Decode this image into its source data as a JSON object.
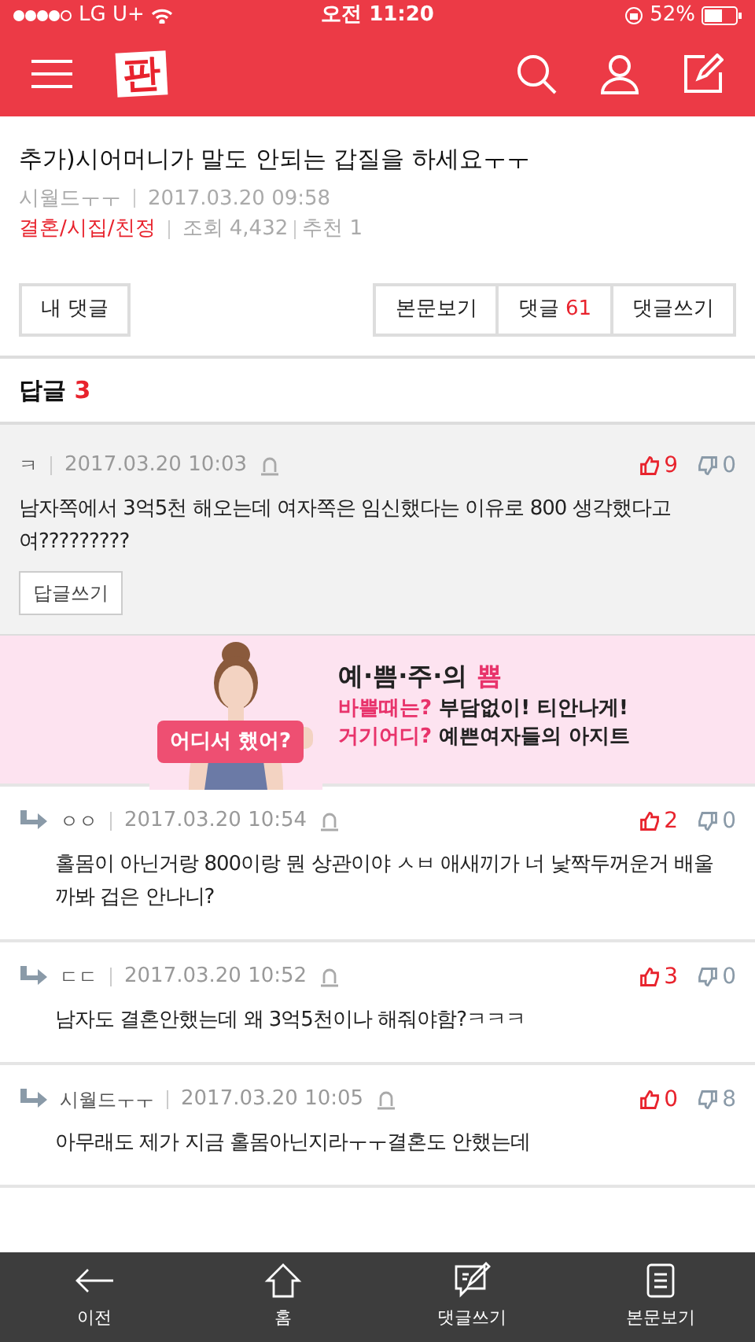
{
  "status_bar": {
    "carrier": "LG U+",
    "time": "오전 11:20",
    "battery": "52%"
  },
  "header": {
    "logo": "판"
  },
  "post": {
    "title": "추가)시어머니가 말도 안되는 갑질을 하세요ㅜㅜ",
    "author": "시월드ㅜㅜ",
    "date": "2017.03.20 09:58",
    "category": "결혼/시집/친정",
    "views": "조회 4,432",
    "recommends": "추천 1"
  },
  "actions": {
    "my_comments": "내 댓글",
    "tabs": [
      {
        "label": "본문보기"
      },
      {
        "label": "댓글",
        "count": "61"
      },
      {
        "label": "댓글쓰기"
      }
    ]
  },
  "replies_header": {
    "label": "답글",
    "count": "3"
  },
  "comments": [
    {
      "kind": "parent",
      "author": "ㅋ",
      "date": "2017.03.20 10:03",
      "likes": "9",
      "dislikes": "0",
      "text": "남자쪽에서 3억5천 해오는데 여자쪽은 임신했다는 이유로 800 생각했다고여?????????",
      "reply_button": "답글쓰기"
    },
    {
      "kind": "reply",
      "author": "ㅇㅇ",
      "date": "2017.03.20 10:54",
      "likes": "2",
      "dislikes": "0",
      "text": "홀몸이 아닌거랑 800이랑 뭔 상관이야 ㅅㅂ 애새끼가 너 낯짝두꺼운거 배울까봐 겁은 안나니?"
    },
    {
      "kind": "reply",
      "author": "ㄷㄷ",
      "date": "2017.03.20 10:52",
      "likes": "3",
      "dislikes": "0",
      "text": "남자도 결혼안했는데 왜 3억5천이나 해줘야함?ㅋㅋㅋ"
    },
    {
      "kind": "reply",
      "author": "시월드ㅜㅜ",
      "date": "2017.03.20 10:05",
      "likes": "0",
      "dislikes": "8",
      "text": "아무래도 제가 지금 홀몸아닌지라ㅜㅜ결혼도 안했는데"
    }
  ],
  "ad": {
    "sign": "어디서 했어?",
    "title": "예·쁨·주·의",
    "title_accent": "뿀",
    "lines": [
      {
        "accent": "바쁠때는?",
        "text": "부담없이! 티안나게!"
      },
      {
        "accent": "거기어디?",
        "text": "예쁜여자들의 아지트"
      }
    ]
  },
  "bottom_nav": [
    {
      "kind": "back",
      "label": "이전"
    },
    {
      "kind": "home",
      "label": "홈"
    },
    {
      "kind": "write",
      "label": "댓글쓰기"
    },
    {
      "kind": "article",
      "label": "본문보기"
    }
  ]
}
